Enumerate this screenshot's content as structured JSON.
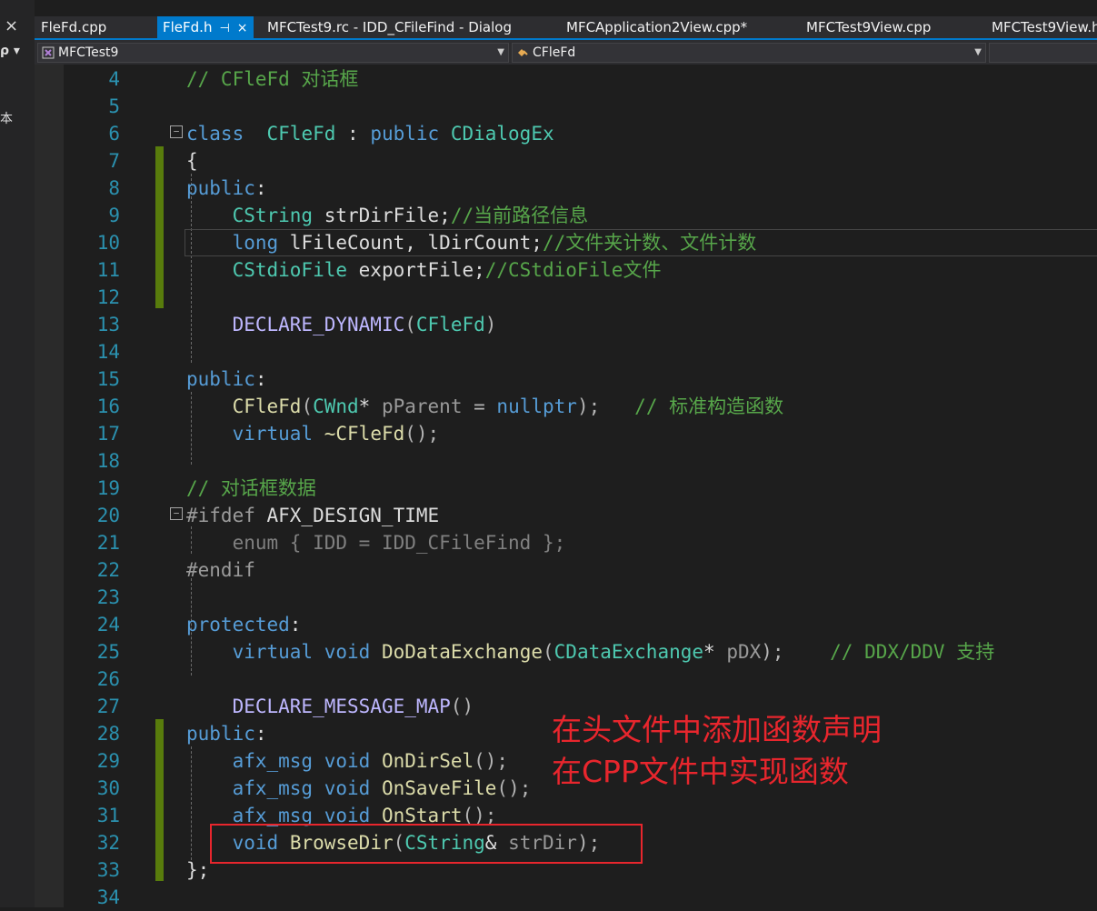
{
  "left_strip": {
    "close_glyph": "×",
    "glyph": "ρ ▾",
    "label": "本"
  },
  "tabs": [
    {
      "label": "FleFd.cpp",
      "active": false
    },
    {
      "label": "FleFd.h",
      "active": true,
      "pin": "⊣",
      "close": "×"
    },
    {
      "label": "MFCTest9.rc - IDD_CFileFind - Dialog",
      "active": false
    },
    {
      "label": "MFCApplication2View.cpp*",
      "active": false
    },
    {
      "label": "MFCTest9View.cpp",
      "active": false
    },
    {
      "label": "MFCTest9View.h",
      "active": false
    }
  ],
  "nav": {
    "project": "MFCTest9",
    "scope": "CFleFd",
    "project_icon": "project-icon",
    "scope_icon": "class-icon"
  },
  "lines": [
    {
      "n": "4",
      "segs": [
        [
          "cm",
          "// CFleFd 对话框"
        ]
      ]
    },
    {
      "n": "5",
      "segs": []
    },
    {
      "n": "6",
      "segs": [
        [
          "kw",
          "class"
        ],
        [
          "",
          "  "
        ],
        [
          "ty",
          "CFleFd"
        ],
        [
          "",
          " : "
        ],
        [
          "kw",
          "public"
        ],
        [
          "",
          " "
        ],
        [
          "ty",
          "CDialogEx"
        ]
      ]
    },
    {
      "n": "7",
      "segs": [
        [
          "",
          "{"
        ]
      ]
    },
    {
      "n": "8",
      "segs": [
        [
          "kw",
          "public"
        ],
        [
          "",
          ":"
        ]
      ]
    },
    {
      "n": "9",
      "segs": [
        [
          "",
          "    "
        ],
        [
          "ty",
          "CString"
        ],
        [
          "",
          " strDirFile;"
        ],
        [
          "cm",
          "//当前路径信息"
        ]
      ]
    },
    {
      "n": "10",
      "segs": [
        [
          "",
          "    "
        ],
        [
          "kw",
          "long"
        ],
        [
          "",
          " lFileCount, lDirCount;"
        ],
        [
          "cm",
          "//文件夹计数、文件计数"
        ]
      ]
    },
    {
      "n": "11",
      "segs": [
        [
          "",
          "    "
        ],
        [
          "ty",
          "CStdioFile"
        ],
        [
          "",
          " exportFile;"
        ],
        [
          "cm",
          "//CStdioFile文件"
        ]
      ]
    },
    {
      "n": "12",
      "segs": []
    },
    {
      "n": "13",
      "segs": [
        [
          "",
          "    "
        ],
        [
          "mc",
          "DECLARE_DYNAMIC"
        ],
        [
          "op",
          "("
        ],
        [
          "ty",
          "CFleFd"
        ],
        [
          "op",
          ")"
        ]
      ]
    },
    {
      "n": "14",
      "segs": []
    },
    {
      "n": "15",
      "segs": [
        [
          "kw",
          "public"
        ],
        [
          "",
          ":"
        ]
      ]
    },
    {
      "n": "16",
      "segs": [
        [
          "",
          "    "
        ],
        [
          "fn",
          "CFleFd"
        ],
        [
          "op",
          "("
        ],
        [
          "ty",
          "CWnd"
        ],
        [
          "",
          "* "
        ],
        [
          "prm",
          "pParent"
        ],
        [
          "op",
          " = "
        ],
        [
          "kw",
          "nullptr"
        ],
        [
          "op",
          ");"
        ],
        [
          "",
          "   "
        ],
        [
          "cm",
          "// 标准构造函数"
        ]
      ]
    },
    {
      "n": "17",
      "segs": [
        [
          "",
          "    "
        ],
        [
          "kw",
          "virtual"
        ],
        [
          "",
          " "
        ],
        [
          "fn",
          "~CFleFd"
        ],
        [
          "op",
          "();"
        ]
      ]
    },
    {
      "n": "18",
      "segs": []
    },
    {
      "n": "19",
      "segs": [
        [
          "cm",
          "// 对话框数据"
        ]
      ]
    },
    {
      "n": "20",
      "segs": [
        [
          "pp",
          "#ifdef"
        ],
        [
          "",
          " AFX_DESIGN_TIME"
        ]
      ]
    },
    {
      "n": "21",
      "segs": [
        [
          "",
          "    "
        ],
        [
          "gray",
          "enum { IDD = IDD_CFileFind };"
        ]
      ]
    },
    {
      "n": "22",
      "segs": [
        [
          "pp",
          "#endif"
        ]
      ]
    },
    {
      "n": "23",
      "segs": []
    },
    {
      "n": "24",
      "segs": [
        [
          "kw",
          "protected"
        ],
        [
          "",
          ":"
        ]
      ]
    },
    {
      "n": "25",
      "segs": [
        [
          "",
          "    "
        ],
        [
          "kw",
          "virtual"
        ],
        [
          "",
          " "
        ],
        [
          "kw",
          "void"
        ],
        [
          "",
          " "
        ],
        [
          "fn",
          "DoDataExchange"
        ],
        [
          "op",
          "("
        ],
        [
          "ty",
          "CDataExchange"
        ],
        [
          "",
          "* "
        ],
        [
          "prm",
          "pDX"
        ],
        [
          "op",
          ");"
        ],
        [
          "",
          "    "
        ],
        [
          "cm",
          "// DDX/DDV 支持"
        ]
      ]
    },
    {
      "n": "26",
      "segs": []
    },
    {
      "n": "27",
      "segs": [
        [
          "",
          "    "
        ],
        [
          "mc",
          "DECLARE_MESSAGE_MAP"
        ],
        [
          "op",
          "()"
        ]
      ]
    },
    {
      "n": "28",
      "segs": [
        [
          "kw",
          "public"
        ],
        [
          "",
          ":"
        ]
      ]
    },
    {
      "n": "29",
      "segs": [
        [
          "",
          "    "
        ],
        [
          "kw",
          "afx_msg"
        ],
        [
          "",
          " "
        ],
        [
          "kw",
          "void"
        ],
        [
          "",
          " "
        ],
        [
          "fn",
          "OnDirSel"
        ],
        [
          "op",
          "();"
        ]
      ]
    },
    {
      "n": "30",
      "segs": [
        [
          "",
          "    "
        ],
        [
          "kw",
          "afx_msg"
        ],
        [
          "",
          " "
        ],
        [
          "kw",
          "void"
        ],
        [
          "",
          " "
        ],
        [
          "fn",
          "OnSaveFile"
        ],
        [
          "op",
          "();"
        ]
      ]
    },
    {
      "n": "31",
      "segs": [
        [
          "",
          "    "
        ],
        [
          "kw",
          "afx_msg"
        ],
        [
          "",
          " "
        ],
        [
          "kw",
          "void"
        ],
        [
          "",
          " "
        ],
        [
          "fn",
          "OnStart"
        ],
        [
          "op",
          "();"
        ]
      ]
    },
    {
      "n": "32",
      "segs": [
        [
          "",
          "    "
        ],
        [
          "kw",
          "void"
        ],
        [
          "",
          " "
        ],
        [
          "fn",
          "BrowseDir"
        ],
        [
          "op",
          "("
        ],
        [
          "ty",
          "CString"
        ],
        [
          "",
          "& "
        ],
        [
          "prm",
          "strDir"
        ],
        [
          "op",
          ");"
        ]
      ]
    },
    {
      "n": "33",
      "segs": [
        [
          "",
          "};"
        ]
      ]
    },
    {
      "n": "34",
      "segs": []
    }
  ],
  "annotation": [
    "在头文件中添加函数声明",
    "在CPP文件中实现函数"
  ],
  "colors": {
    "accent": "#007acc",
    "annotation": "#e8262d",
    "changed_bar": "#587c0c"
  }
}
